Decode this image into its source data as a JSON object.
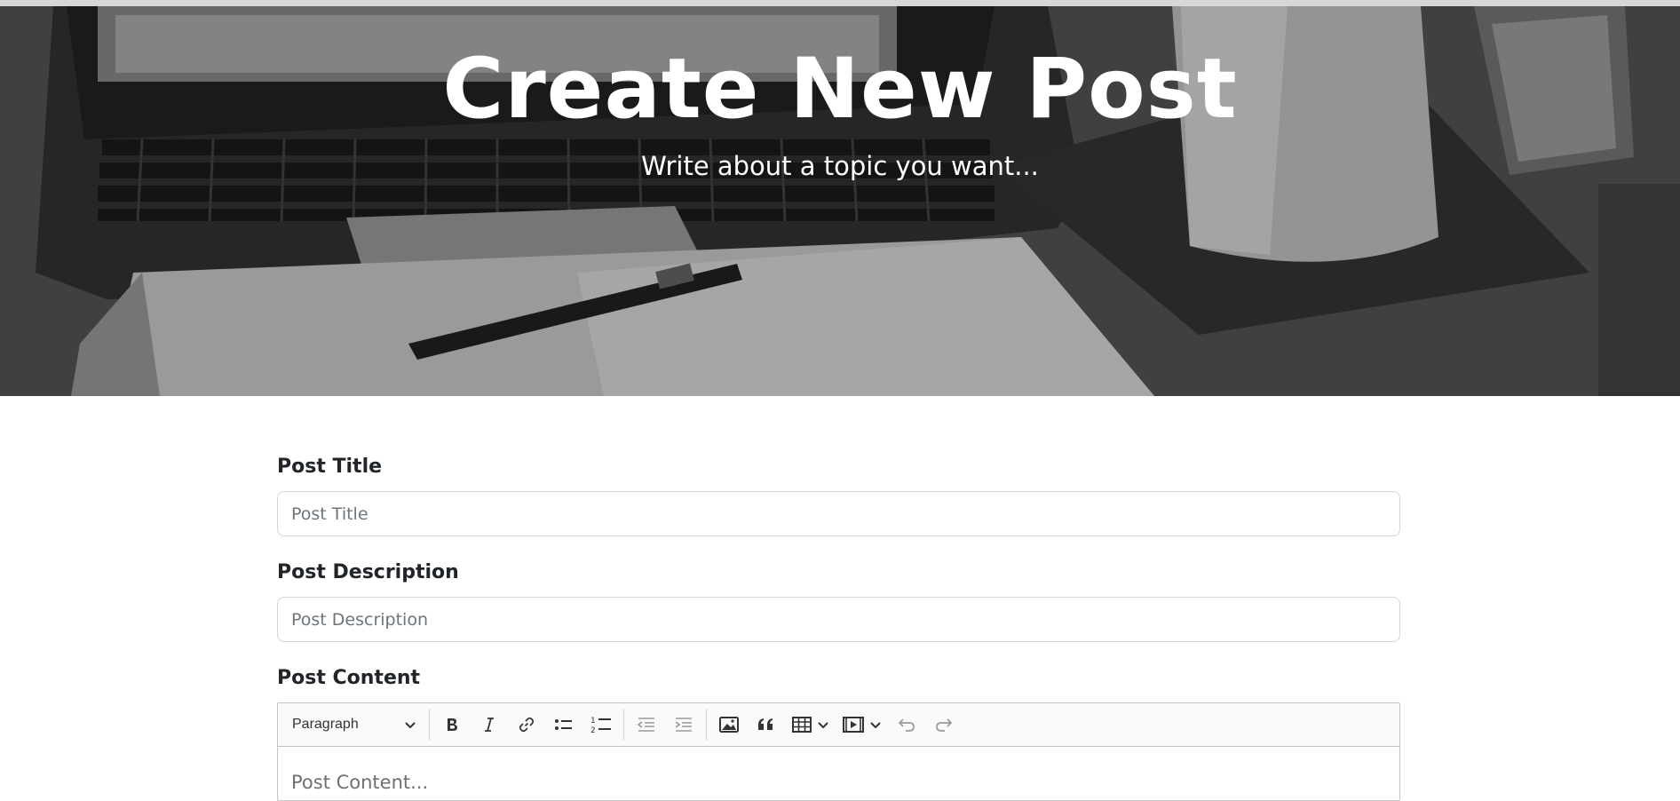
{
  "hero": {
    "title": "Create New Post",
    "subtitle": "Write about a topic you want..."
  },
  "form": {
    "title_label": "Post Title",
    "title_placeholder": "Post Title",
    "description_label": "Post Description",
    "description_placeholder": "Post Description",
    "content_label": "Post Content"
  },
  "editor": {
    "heading_select": "Paragraph",
    "toolbar_icons": [
      "bold-icon",
      "italic-icon",
      "link-icon",
      "bulleted-list-icon",
      "numbered-list-icon",
      "outdent-icon",
      "indent-icon",
      "image-icon",
      "blockquote-icon",
      "table-icon",
      "media-icon",
      "undo-icon",
      "redo-icon"
    ],
    "content_placeholder": "Post Content..."
  },
  "colors": {
    "hero_overlay": "#3d3d3d",
    "text": "#212529",
    "placeholder": "#6c757d",
    "border": "#d3d6da"
  }
}
